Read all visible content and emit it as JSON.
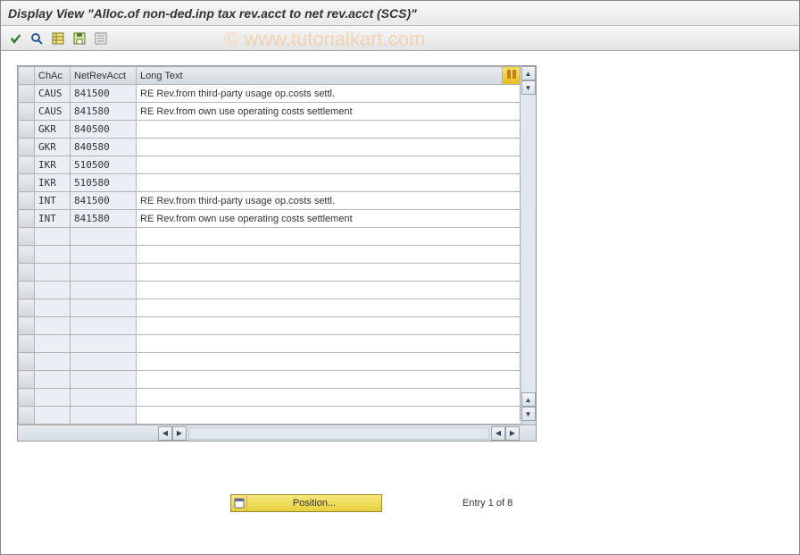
{
  "header": {
    "title": "Display View \"Alloc.of non-ded.inp tax rev.acct to net rev.acct (SCS)\""
  },
  "toolbar": {
    "icons": [
      "check-icon",
      "find-icon",
      "table-icon",
      "save-icon",
      "list-icon"
    ]
  },
  "watermark": "© www.tutorialkart.com",
  "table": {
    "columns": {
      "chac": "ChAc",
      "netrev": "NetRevAcct",
      "longtext": "Long Text"
    },
    "total_rows": 19,
    "rows": [
      {
        "chac": "CAUS",
        "netrev": "841500",
        "longtext": "RE Rev.from third-party usage op.costs settl."
      },
      {
        "chac": "CAUS",
        "netrev": "841580",
        "longtext": "RE Rev.from own use operating costs settlement"
      },
      {
        "chac": "GKR",
        "netrev": "840500",
        "longtext": ""
      },
      {
        "chac": "GKR",
        "netrev": "840580",
        "longtext": ""
      },
      {
        "chac": "IKR",
        "netrev": "510500",
        "longtext": ""
      },
      {
        "chac": "IKR",
        "netrev": "510580",
        "longtext": ""
      },
      {
        "chac": "INT",
        "netrev": "841500",
        "longtext": "RE Rev.from third-party usage op.costs settl."
      },
      {
        "chac": "INT",
        "netrev": "841580",
        "longtext": "RE Rev.from own use operating costs settlement"
      }
    ]
  },
  "footer": {
    "position_label": "Position...",
    "entry_text": "Entry 1 of 8"
  }
}
